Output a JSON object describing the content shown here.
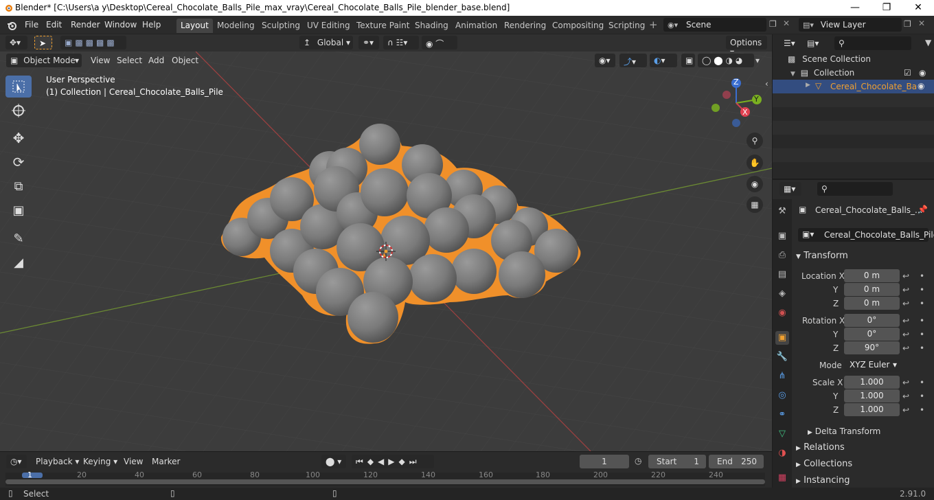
{
  "window": {
    "title": "Blender* [C:\\Users\\a y\\Desktop\\Cereal_Chocolate_Balls_Pile_max_vray\\Cereal_Chocolate_Balls_Pile_blender_base.blend]"
  },
  "menu": [
    "File",
    "Edit",
    "Render",
    "Window",
    "Help"
  ],
  "workspaces": [
    "Layout",
    "Modeling",
    "Sculpting",
    "UV Editing",
    "Texture Paint",
    "Shading",
    "Animation",
    "Rendering",
    "Compositing",
    "Scripting"
  ],
  "active_workspace": "Layout",
  "scene": {
    "name": "Scene",
    "view_layer": "View Layer"
  },
  "tool_header": {
    "transform_orientation": "Global",
    "options_label": "Options"
  },
  "viewport_header": {
    "mode": "Object Mode",
    "menus": [
      "View",
      "Select",
      "Add",
      "Object"
    ]
  },
  "viewport": {
    "perspective": "User Perspective",
    "collection_info": "(1) Collection | Cereal_Chocolate_Balls_Pile"
  },
  "gizmo": {
    "x": "X",
    "y": "Y",
    "z": "Z"
  },
  "outliner": {
    "scene_collection": "Scene Collection",
    "collection": "Collection",
    "object": "Cereal_Chocolate_Ba"
  },
  "properties": {
    "object_name_header": "Cereal_Chocolate_Balls_...",
    "object_name_field": "Cereal_Chocolate_Balls_Pile",
    "transform_label": "Transform",
    "location_label": "Location X",
    "rotation_label": "Rotation X",
    "scale_label": "Scale X",
    "y_label": "Y",
    "z_label": "Z",
    "location": [
      "0 m",
      "0 m",
      "0 m"
    ],
    "rotation": [
      "0°",
      "0°",
      "90°"
    ],
    "mode_label": "Mode",
    "mode_value": "XYZ Euler",
    "scale": [
      "1.000",
      "1.000",
      "1.000"
    ],
    "delta_transform": "Delta Transform",
    "relations": "Relations",
    "collections": "Collections",
    "instancing": "Instancing"
  },
  "timeline": {
    "menus": [
      "Playback",
      "Keying",
      "View",
      "Marker"
    ],
    "current_frame": "1",
    "start_label": "Start",
    "start": "1",
    "end_label": "End",
    "end": "250",
    "ruler": [
      "1",
      "20",
      "40",
      "60",
      "80",
      "100",
      "120",
      "140",
      "160",
      "180",
      "200",
      "220",
      "240"
    ]
  },
  "statusbar": {
    "left": "Select",
    "version": "2.91.0"
  },
  "colors": {
    "accent": "#4b6fa8",
    "selection_outline": "#f0902a",
    "viewport_bg": "#3c3c3c"
  }
}
